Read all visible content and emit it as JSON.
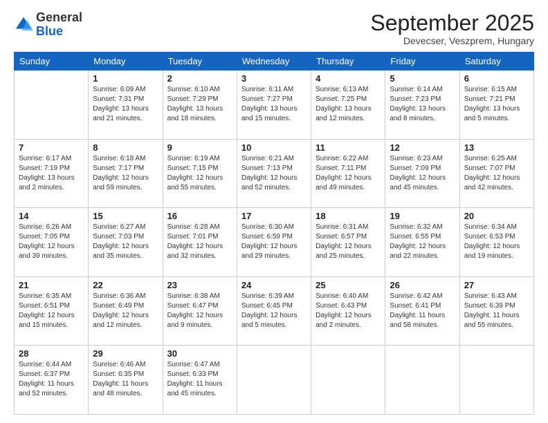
{
  "logo": {
    "general": "General",
    "blue": "Blue"
  },
  "header": {
    "month": "September 2025",
    "location": "Devecser, Veszprem, Hungary"
  },
  "weekdays": [
    "Sunday",
    "Monday",
    "Tuesday",
    "Wednesday",
    "Thursday",
    "Friday",
    "Saturday"
  ],
  "weeks": [
    [
      {
        "day": "",
        "sunrise": "",
        "sunset": "",
        "daylight": ""
      },
      {
        "day": "1",
        "sunrise": "Sunrise: 6:09 AM",
        "sunset": "Sunset: 7:31 PM",
        "daylight": "Daylight: 13 hours and 21 minutes."
      },
      {
        "day": "2",
        "sunrise": "Sunrise: 6:10 AM",
        "sunset": "Sunset: 7:29 PM",
        "daylight": "Daylight: 13 hours and 18 minutes."
      },
      {
        "day": "3",
        "sunrise": "Sunrise: 6:11 AM",
        "sunset": "Sunset: 7:27 PM",
        "daylight": "Daylight: 13 hours and 15 minutes."
      },
      {
        "day": "4",
        "sunrise": "Sunrise: 6:13 AM",
        "sunset": "Sunset: 7:25 PM",
        "daylight": "Daylight: 13 hours and 12 minutes."
      },
      {
        "day": "5",
        "sunrise": "Sunrise: 6:14 AM",
        "sunset": "Sunset: 7:23 PM",
        "daylight": "Daylight: 13 hours and 8 minutes."
      },
      {
        "day": "6",
        "sunrise": "Sunrise: 6:15 AM",
        "sunset": "Sunset: 7:21 PM",
        "daylight": "Daylight: 13 hours and 5 minutes."
      }
    ],
    [
      {
        "day": "7",
        "sunrise": "Sunrise: 6:17 AM",
        "sunset": "Sunset: 7:19 PM",
        "daylight": "Daylight: 13 hours and 2 minutes."
      },
      {
        "day": "8",
        "sunrise": "Sunrise: 6:18 AM",
        "sunset": "Sunset: 7:17 PM",
        "daylight": "Daylight: 12 hours and 59 minutes."
      },
      {
        "day": "9",
        "sunrise": "Sunrise: 6:19 AM",
        "sunset": "Sunset: 7:15 PM",
        "daylight": "Daylight: 12 hours and 55 minutes."
      },
      {
        "day": "10",
        "sunrise": "Sunrise: 6:21 AM",
        "sunset": "Sunset: 7:13 PM",
        "daylight": "Daylight: 12 hours and 52 minutes."
      },
      {
        "day": "11",
        "sunrise": "Sunrise: 6:22 AM",
        "sunset": "Sunset: 7:11 PM",
        "daylight": "Daylight: 12 hours and 49 minutes."
      },
      {
        "day": "12",
        "sunrise": "Sunrise: 6:23 AM",
        "sunset": "Sunset: 7:09 PM",
        "daylight": "Daylight: 12 hours and 45 minutes."
      },
      {
        "day": "13",
        "sunrise": "Sunrise: 6:25 AM",
        "sunset": "Sunset: 7:07 PM",
        "daylight": "Daylight: 12 hours and 42 minutes."
      }
    ],
    [
      {
        "day": "14",
        "sunrise": "Sunrise: 6:26 AM",
        "sunset": "Sunset: 7:05 PM",
        "daylight": "Daylight: 12 hours and 39 minutes."
      },
      {
        "day": "15",
        "sunrise": "Sunrise: 6:27 AM",
        "sunset": "Sunset: 7:03 PM",
        "daylight": "Daylight: 12 hours and 35 minutes."
      },
      {
        "day": "16",
        "sunrise": "Sunrise: 6:28 AM",
        "sunset": "Sunset: 7:01 PM",
        "daylight": "Daylight: 12 hours and 32 minutes."
      },
      {
        "day": "17",
        "sunrise": "Sunrise: 6:30 AM",
        "sunset": "Sunset: 6:59 PM",
        "daylight": "Daylight: 12 hours and 29 minutes."
      },
      {
        "day": "18",
        "sunrise": "Sunrise: 6:31 AM",
        "sunset": "Sunset: 6:57 PM",
        "daylight": "Daylight: 12 hours and 25 minutes."
      },
      {
        "day": "19",
        "sunrise": "Sunrise: 6:32 AM",
        "sunset": "Sunset: 6:55 PM",
        "daylight": "Daylight: 12 hours and 22 minutes."
      },
      {
        "day": "20",
        "sunrise": "Sunrise: 6:34 AM",
        "sunset": "Sunset: 6:53 PM",
        "daylight": "Daylight: 12 hours and 19 minutes."
      }
    ],
    [
      {
        "day": "21",
        "sunrise": "Sunrise: 6:35 AM",
        "sunset": "Sunset: 6:51 PM",
        "daylight": "Daylight: 12 hours and 15 minutes."
      },
      {
        "day": "22",
        "sunrise": "Sunrise: 6:36 AM",
        "sunset": "Sunset: 6:49 PM",
        "daylight": "Daylight: 12 hours and 12 minutes."
      },
      {
        "day": "23",
        "sunrise": "Sunrise: 6:38 AM",
        "sunset": "Sunset: 6:47 PM",
        "daylight": "Daylight: 12 hours and 9 minutes."
      },
      {
        "day": "24",
        "sunrise": "Sunrise: 6:39 AM",
        "sunset": "Sunset: 6:45 PM",
        "daylight": "Daylight: 12 hours and 5 minutes."
      },
      {
        "day": "25",
        "sunrise": "Sunrise: 6:40 AM",
        "sunset": "Sunset: 6:43 PM",
        "daylight": "Daylight: 12 hours and 2 minutes."
      },
      {
        "day": "26",
        "sunrise": "Sunrise: 6:42 AM",
        "sunset": "Sunset: 6:41 PM",
        "daylight": "Daylight: 11 hours and 58 minutes."
      },
      {
        "day": "27",
        "sunrise": "Sunrise: 6:43 AM",
        "sunset": "Sunset: 6:39 PM",
        "daylight": "Daylight: 11 hours and 55 minutes."
      }
    ],
    [
      {
        "day": "28",
        "sunrise": "Sunrise: 6:44 AM",
        "sunset": "Sunset: 6:37 PM",
        "daylight": "Daylight: 11 hours and 52 minutes."
      },
      {
        "day": "29",
        "sunrise": "Sunrise: 6:46 AM",
        "sunset": "Sunset: 6:35 PM",
        "daylight": "Daylight: 11 hours and 48 minutes."
      },
      {
        "day": "30",
        "sunrise": "Sunrise: 6:47 AM",
        "sunset": "Sunset: 6:33 PM",
        "daylight": "Daylight: 11 hours and 45 minutes."
      },
      {
        "day": "",
        "sunrise": "",
        "sunset": "",
        "daylight": ""
      },
      {
        "day": "",
        "sunrise": "",
        "sunset": "",
        "daylight": ""
      },
      {
        "day": "",
        "sunrise": "",
        "sunset": "",
        "daylight": ""
      },
      {
        "day": "",
        "sunrise": "",
        "sunset": "",
        "daylight": ""
      }
    ]
  ]
}
